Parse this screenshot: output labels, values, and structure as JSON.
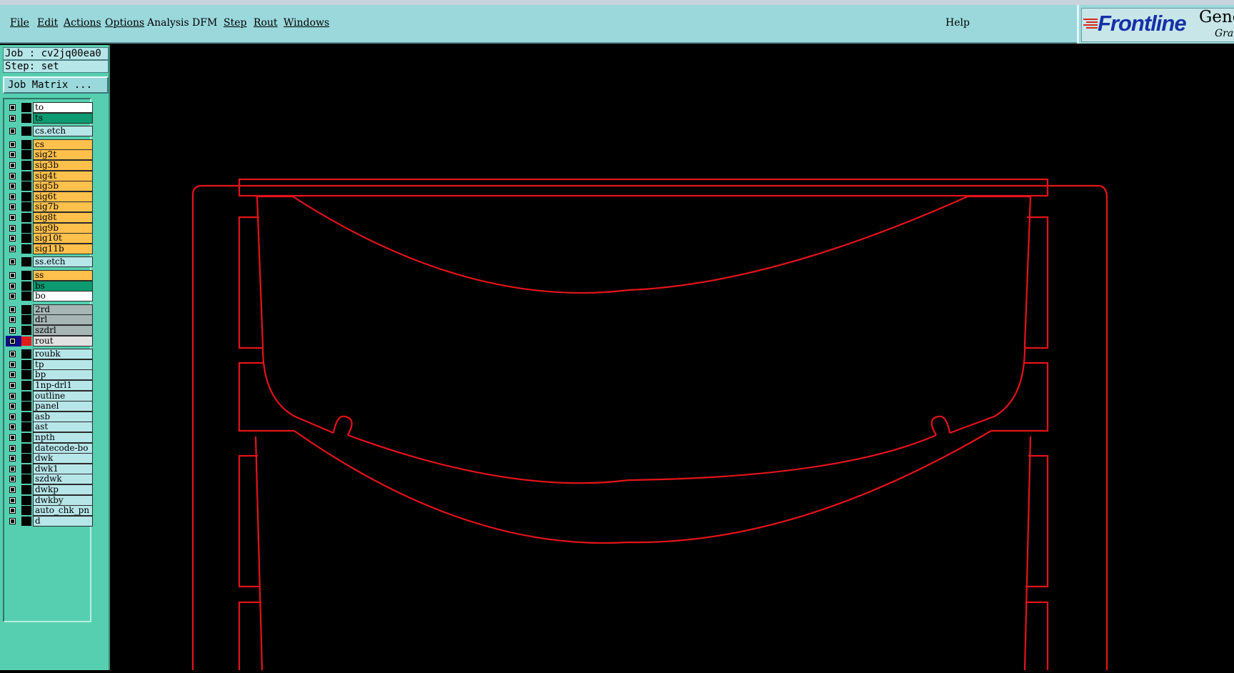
{
  "menu": {
    "items": [
      {
        "label": "File",
        "underline": true
      },
      {
        "label": "Edit",
        "underline": true
      },
      {
        "label": "Actions",
        "underline": true
      },
      {
        "label": "Options",
        "underline": true
      },
      {
        "label": "Analysis",
        "underline": false
      },
      {
        "label": "DFM",
        "underline": false
      },
      {
        "label": "Step",
        "underline": true
      },
      {
        "label": "Rout",
        "underline": true
      },
      {
        "label": "Windows",
        "underline": true
      }
    ],
    "help": "Help"
  },
  "logo": {
    "brand": "Frontline",
    "product": "Gene",
    "subtitle": "Grap"
  },
  "job": {
    "job_line": "Job : cv2jq00ea0",
    "step_line": "Step: set",
    "matrix_button": "Job Matrix ..."
  },
  "colors": {
    "menubar": "#9ad8dc",
    "panel": "#56cfb0",
    "outline": "#e3141a",
    "solder_mask": "#0e9a70",
    "silk": "#ffffff",
    "signal": "#ffc04c",
    "drill": "#a7b5b5",
    "doc": "#b7e6e9",
    "active_layer": "#e31a1a"
  },
  "layers": [
    {
      "name": "to",
      "kind": "silk"
    },
    {
      "name": "ts",
      "kind": "solder_mask"
    },
    {
      "name": "cs.etch",
      "kind": "doc"
    },
    {
      "name": "cs",
      "kind": "signal"
    },
    {
      "name": "sig2t",
      "kind": "signal"
    },
    {
      "name": "sig3b",
      "kind": "signal"
    },
    {
      "name": "sig4t",
      "kind": "signal"
    },
    {
      "name": "sig5b",
      "kind": "signal"
    },
    {
      "name": "sig6t",
      "kind": "signal"
    },
    {
      "name": "sig7b",
      "kind": "signal"
    },
    {
      "name": "sig8t",
      "kind": "signal"
    },
    {
      "name": "sig9b",
      "kind": "signal"
    },
    {
      "name": "sig10t",
      "kind": "signal"
    },
    {
      "name": "sig11b",
      "kind": "signal"
    },
    {
      "name": "ss.etch",
      "kind": "doc"
    },
    {
      "name": "ss",
      "kind": "signal"
    },
    {
      "name": "bs",
      "kind": "solder_mask"
    },
    {
      "name": "bo",
      "kind": "silk"
    },
    {
      "name": "2rd",
      "kind": "drill"
    },
    {
      "name": "drl",
      "kind": "drill"
    },
    {
      "name": "szdrl",
      "kind": "drill"
    },
    {
      "name": "rout",
      "kind": "drill",
      "active": true
    },
    {
      "name": "roubk",
      "kind": "doc"
    },
    {
      "name": "tp",
      "kind": "doc"
    },
    {
      "name": "bp",
      "kind": "doc"
    },
    {
      "name": "1np-drl1",
      "kind": "doc"
    },
    {
      "name": "outline",
      "kind": "doc"
    },
    {
      "name": "panel",
      "kind": "doc"
    },
    {
      "name": "asb",
      "kind": "doc"
    },
    {
      "name": "ast",
      "kind": "doc"
    },
    {
      "name": "npth",
      "kind": "doc"
    },
    {
      "name": "datecode-bo",
      "kind": "doc"
    },
    {
      "name": "dwk",
      "kind": "doc"
    },
    {
      "name": "dwk1",
      "kind": "doc"
    },
    {
      "name": "szdwk",
      "kind": "doc"
    },
    {
      "name": "dwkp",
      "kind": "doc"
    },
    {
      "name": "dwkby",
      "kind": "doc"
    },
    {
      "name": "auto_chk_pn",
      "kind": "doc"
    },
    {
      "name": "d",
      "kind": "doc"
    }
  ]
}
